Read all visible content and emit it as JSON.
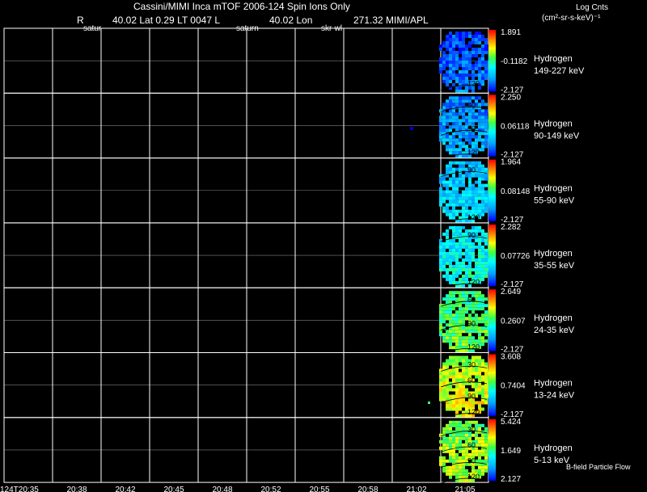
{
  "header": {
    "line1": "Cassini/MIMI Inca mTOF  2006-124   Spin    Ions Only",
    "line2_items": [
      "R",
      "40.02 Lat 0.29 LT 0047 L",
      "40.02 Lon",
      "271.32  MIMI/APL"
    ],
    "overlay_labels": [
      "satur",
      "saturn",
      "skr-wl"
    ]
  },
  "units": {
    "line1": "Log Cnts",
    "line2": "(cm²-sr-s-keV)⁻¹"
  },
  "footer_note": "B-field Particle Flow",
  "chart_data": {
    "type": "heatmap",
    "x_tick_labels": [
      "124T20:35",
      "20:38",
      "20:42",
      "20:45",
      "20:48",
      "20:52",
      "20:55",
      "20:58",
      "21:02",
      "21:05"
    ],
    "grid": true,
    "colorbar": [
      "blue",
      "cyan",
      "green",
      "yellow",
      "orange",
      "red"
    ],
    "panels": [
      {
        "species": "Hydrogen",
        "energy": "149-227 keV",
        "cb_max": "1.891",
        "cb_mid": "-0.1182",
        "cb_min": "-2.127",
        "image_level": 0.12,
        "contours": [
          "120"
        ]
      },
      {
        "species": "Hydrogen",
        "energy": "90-149 keV",
        "cb_max": "2.250",
        "cb_mid": "0.06118",
        "cb_min": "-2.127",
        "image_level": 0.2,
        "contours": [
          "60",
          "90",
          "120"
        ]
      },
      {
        "species": "Hydrogen",
        "energy": "55-90 keV",
        "cb_max": "1.964",
        "cb_mid": "0.08148",
        "cb_min": "-2.127",
        "image_level": 0.3,
        "contours": [
          "90",
          "120"
        ]
      },
      {
        "species": "Hydrogen",
        "energy": "35-55 keV",
        "cb_max": "2.282",
        "cb_mid": "0.07726",
        "cb_min": "-2.127",
        "image_level": 0.38,
        "contours": [
          "90",
          "120"
        ]
      },
      {
        "species": "Hydrogen",
        "energy": "24-35 keV",
        "cb_max": "2.649",
        "cb_mid": "0.2607",
        "cb_min": "-2.127",
        "image_level": 0.52,
        "contours": [
          "60",
          "90",
          "120"
        ]
      },
      {
        "species": "Hydrogen",
        "energy": "13-24 keV",
        "cb_max": "3.608",
        "cb_mid": "0.7404",
        "cb_min": "-2.127",
        "image_level": 0.66,
        "contours": [
          "30",
          "60",
          "90",
          "120"
        ]
      },
      {
        "species": "Hydrogen",
        "energy": "5-13 keV",
        "cb_max": "5.424",
        "cb_mid": "1.649",
        "cb_min": "2.127",
        "image_level": 0.6,
        "contours": [
          "30",
          "60",
          "90",
          "120"
        ]
      }
    ]
  }
}
